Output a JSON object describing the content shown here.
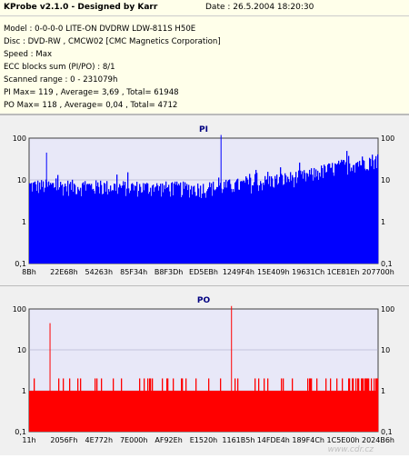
{
  "app_title": "KProbe v2.1.0 - Designed by Karr",
  "date": "Date : 26.5.2004 18:20:30",
  "info_lines": [
    "Model : 0-0-0-0 LITE-ON DVDRW LDW-811S  H50E",
    "Disc : DVD-RW , CMCW02 [CMC Magnetics Corporation]",
    "Speed : Max",
    "ECC blocks sum (PI/PO) : 8/1",
    "Scanned range : 0 - 231079h",
    "PI Max= 119 , Average= 3,69 , Total= 61948",
    "PO Max= 118 , Average= 0,04 , Total= 4712"
  ],
  "watermark": "www.cdr.cz",
  "chart_data": [
    {
      "type": "bar",
      "title": "PI",
      "yscale": "log",
      "ylim": [
        0.1,
        100
      ],
      "yticks": [
        "100",
        "10",
        "1",
        "0,1"
      ],
      "xticks": [
        "8Bh",
        "22E68h",
        "54263h",
        "85F34h",
        "B8F3Dh",
        "ED5EBh",
        "1249F4h",
        "15E409h",
        "19631Ch",
        "1CE81Eh",
        "207700h"
      ],
      "color": "#0000ff",
      "baseline_profile": [
        {
          "pos": 0.0,
          "value": 7
        },
        {
          "pos": 0.5,
          "value": 6
        },
        {
          "pos": 0.65,
          "value": 8
        },
        {
          "pos": 0.8,
          "value": 12
        },
        {
          "pos": 1.0,
          "value": 30
        }
      ],
      "spikes": [
        {
          "pos": 0.05,
          "value": 45
        },
        {
          "pos": 0.55,
          "value": 119
        }
      ]
    },
    {
      "type": "bar",
      "title": "PO",
      "yscale": "log",
      "ylim": [
        0.1,
        100
      ],
      "yticks": [
        "100",
        "10",
        "1",
        "0,1"
      ],
      "xticks": [
        "11h",
        "2056Fh",
        "4E772h",
        "7E000h",
        "AF92Eh",
        "E1520h",
        "1161B5h",
        "14FDE4h",
        "189F4Ch",
        "1C5E00h",
        "2024B6h"
      ],
      "color": "#ff0000",
      "typical_value": 1,
      "occasional_value": 2,
      "spikes": [
        {
          "pos": 0.06,
          "value": 45
        },
        {
          "pos": 0.58,
          "value": 118
        }
      ]
    }
  ]
}
